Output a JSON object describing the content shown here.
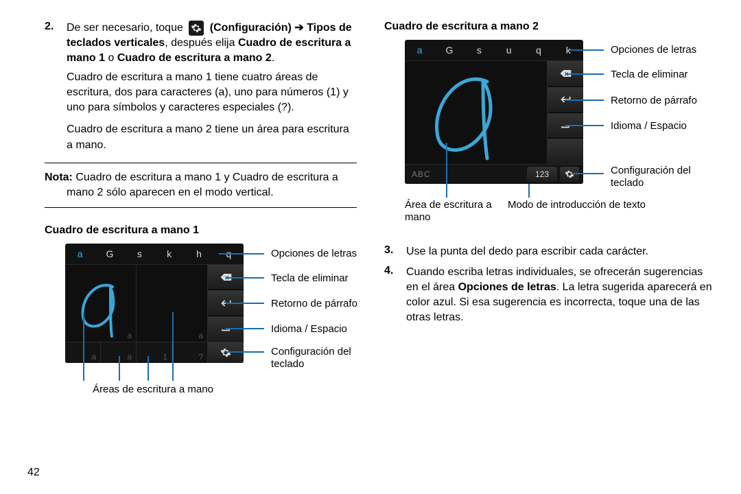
{
  "pageNumber": "42",
  "left": {
    "step2": {
      "num": "2.",
      "part1": "De ser necesario, toque",
      "config": "(Configuración)",
      "arrow": "➔",
      "tipos": "Tipos de teclados verticales",
      "part2": ", después elija",
      "optA": "Cuadro de escritura a mano 1",
      "or": " o ",
      "optB": "Cuadro de escritura a mano 2",
      "dot": ".",
      "para1": "Cuadro de escritura a mano 1 tiene cuatro áreas de escritura, dos para caracteres (a), uno para números (1) y uno para símbolos y caracteres especiales (?).",
      "para2": "Cuadro de escritura a mano 2 tiene un área para escritura a mano."
    },
    "noteLabel": "Nota:",
    "noteText": " Cuadro de escritura a mano 1 y Cuadro de escritura a mano 2 sólo aparecen en el modo vertical.",
    "fig1Title": "Cuadro de escritura a mano 1",
    "fig1": {
      "topLetters": [
        "a",
        "G",
        "s",
        "k",
        "h",
        "q"
      ],
      "bottomHints": [
        "a",
        "a",
        "1",
        "?"
      ],
      "callouts": {
        "letters": "Opciones de letras",
        "del": "Tecla de eliminar",
        "ret": "Retorno de párrafo",
        "space": "Idioma / Espacio",
        "gear": "Configuración del teclado"
      },
      "below": "Áreas de escritura a mano"
    }
  },
  "right": {
    "fig2Title": "Cuadro de escritura a mano 2",
    "fig2": {
      "topLetters": [
        "a",
        "G",
        "s",
        "u",
        "q",
        "k"
      ],
      "abc": "ABC",
      "n123": "123",
      "callouts": {
        "letters": "Opciones de letras",
        "del": "Tecla de eliminar",
        "ret": "Retorno de párrafo",
        "space": "Idioma / Espacio",
        "gear": "Configuración del teclado"
      },
      "belowLeft": "Área de escritura a mano",
      "belowRight": "Modo de introducción de texto"
    },
    "step3": {
      "num": "3.",
      "text": "Use la punta del dedo para escribir cada carácter."
    },
    "step4": {
      "num": "4.",
      "p1": "Cuando escriba letras individuales, se ofrecerán sugerencias en el área ",
      "bold": "Opciones de letras",
      "p2": ". La letra sugerida aparecerá en color azul. Si esa sugerencia es incorrecta, toque una de las otras letras."
    }
  }
}
